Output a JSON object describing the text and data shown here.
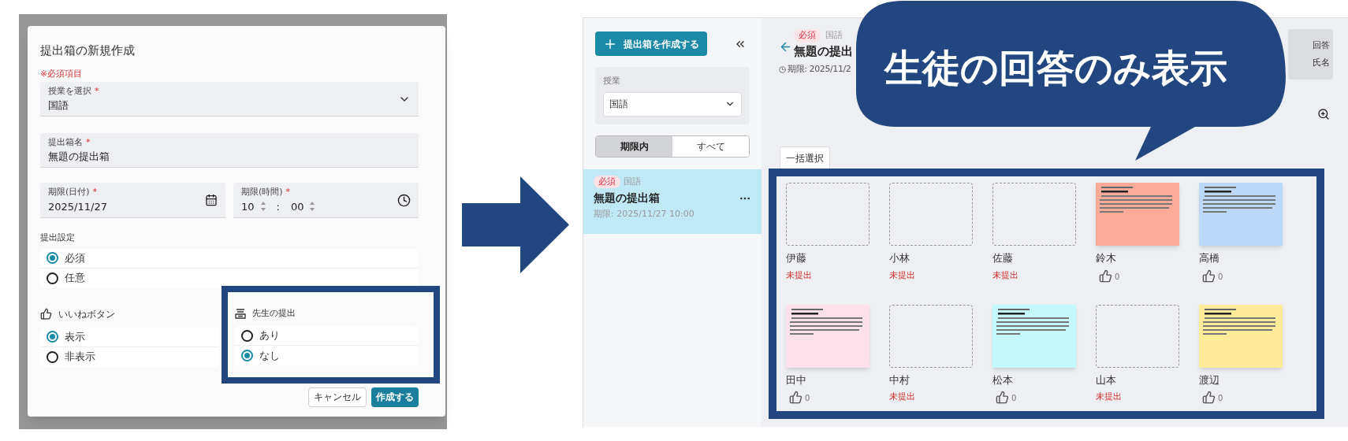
{
  "dialog": {
    "title": "提出箱の新規作成",
    "required_note": "※必須項目",
    "fields": [
      {
        "kind": "select",
        "label": "授業を選択",
        "mark": "*",
        "value": "国語"
      },
      {
        "kind": "text",
        "label": "提出箱名",
        "mark": "*",
        "value": "無題の提出箱"
      }
    ],
    "deadline_date": {
      "label": "期限(日付)",
      "mark": "*",
      "value": "2025/11/27"
    },
    "deadline_time": {
      "label": "期限(時間)",
      "mark": "*",
      "hour": "10",
      "separator": ":",
      "minute": "00"
    },
    "submission_setting": {
      "label": "提出設定",
      "options": [
        {
          "label": "必須",
          "selected": true
        },
        {
          "label": "任意",
          "selected": false
        }
      ]
    },
    "like_button": {
      "label": "いいねボタン",
      "options": [
        {
          "label": "表示",
          "selected": true
        },
        {
          "label": "非表示",
          "selected": false
        }
      ]
    },
    "teacher_submission": {
      "label": "先生の提出",
      "options": [
        {
          "label": "あり",
          "selected": false
        },
        {
          "label": "なし",
          "selected": true
        }
      ]
    },
    "buttons": [
      {
        "kind": "secondary",
        "label": "キャンセル"
      },
      {
        "kind": "primary",
        "label": "作成する"
      }
    ]
  },
  "app": {
    "create_button": "提出箱を作成する",
    "sidebar": {
      "class_label": "授業",
      "class_value": "国語",
      "filter_tabs": [
        {
          "label": "期限内",
          "selected": true
        },
        {
          "label": "すべて",
          "selected": false
        }
      ],
      "items": [
        {
          "badge": "必須",
          "subject": "国語",
          "title": "無題の提出箱",
          "deadline": "期限: 2025/11/27 10:00",
          "selected": true
        }
      ]
    },
    "header": {
      "badge": "必須",
      "subject": "国語",
      "title": "無題の提出",
      "deadline": "期限: 2025/11/2"
    },
    "view_toggle": [
      "回答",
      "氏名"
    ],
    "tab": "一括選択",
    "students": [
      {
        "name": "伊藤",
        "kind": "missing",
        "status": "未提出"
      },
      {
        "name": "小林",
        "kind": "missing",
        "status": "未提出"
      },
      {
        "name": "佐藤",
        "kind": "missing",
        "status": "未提出"
      },
      {
        "name": "鈴木",
        "kind": "submitted",
        "color": "#f9ab98",
        "likes": "0"
      },
      {
        "name": "高橋",
        "kind": "submitted",
        "color": "#bcd8f8",
        "likes": "0"
      },
      {
        "name": "田中",
        "kind": "submitted",
        "color": "#fde1ea",
        "likes": "0"
      },
      {
        "name": "中村",
        "kind": "missing",
        "status": "未提出"
      },
      {
        "name": "松本",
        "kind": "submitted",
        "color": "#c4f8fa",
        "likes": "0"
      },
      {
        "name": "山本",
        "kind": "missing",
        "status": "未提出"
      },
      {
        "name": "渡辺",
        "kind": "submitted",
        "color": "#fdeb9a",
        "likes": "0"
      }
    ]
  },
  "callout": {
    "text": "生徒の回答のみ表示"
  }
}
